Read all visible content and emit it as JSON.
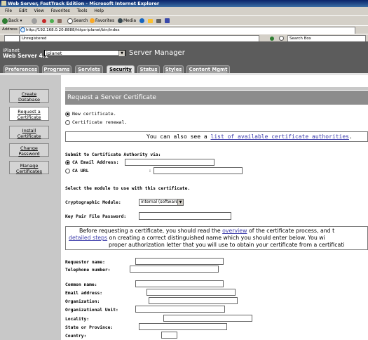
{
  "window": {
    "title": "Web Server, FastTrack Edition - Microsoft Internet Explorer"
  },
  "menu": [
    "File",
    "Edit",
    "View",
    "Favorites",
    "Tools",
    "Help"
  ],
  "toolbar": {
    "back": "Back",
    "search": "Search",
    "favorites": "Favorites",
    "media": "Media"
  },
  "address": {
    "label": "Address",
    "url": "http://192.168.0.20:8888/https-iplanet/bin/index"
  },
  "links": {
    "status": "Unregistered",
    "searchbox": "Search Box"
  },
  "app": {
    "brand_line1": "iPlanet",
    "brand_line2": "Web Server 4.1",
    "server": "iplanet",
    "title": "Server Manager",
    "tabs": [
      "Preferences",
      "Programs",
      "Servlets",
      "Security",
      "Status",
      "Styles",
      "Content Mgmt"
    ],
    "active_tab": "Security"
  },
  "nav": [
    {
      "label1": "Create",
      "label2": "Database"
    },
    {
      "label1": "Request a",
      "label2": "Certificate"
    },
    {
      "label1": "Install",
      "label2": "Certificate"
    },
    {
      "label1": "Change",
      "label2": "Password"
    },
    {
      "label1": "Manage",
      "label2": "Certificates"
    }
  ],
  "page": {
    "title": "Request a Server Certificate",
    "opt_new": "New certificate.",
    "opt_renew": "Certificate renewal.",
    "info_prefix": "You can also see a ",
    "info_link": "list of available certificate authorities",
    "info_suffix": ".",
    "submit_heading": "Submit to Certificate Authority via:",
    "ca_email_label": "CA Email Address:",
    "ca_url_label": "CA URL",
    "ca_url_colon": ":",
    "module_heading": "Select the module to use with this certificate.",
    "crypto_label": "Cryptographic Module:",
    "crypto_value": "internal (software)",
    "keypair_label": "Key Pair File Password:",
    "note_l1_pre": "Before requesting a certificate, you should read the ",
    "note_l1_link": "overview",
    "note_l1_post": " of the certificate process, and t",
    "note_l2_link": "detailed steps",
    "note_l2_post": " on creating a correct distinguished name which you should enter below. You wi",
    "note_l3": "proper authorization letter that you will use to obtain your certificate from a certificati",
    "fields": {
      "requestor": "Requestor name:",
      "telephone": "Telephone number:",
      "common": "Common name:",
      "email": "Email address:",
      "org": "Organization:",
      "orgunit": "Organizational Unit:",
      "locality": "Locality:",
      "state": "State or Province:",
      "country": "Country:"
    }
  }
}
